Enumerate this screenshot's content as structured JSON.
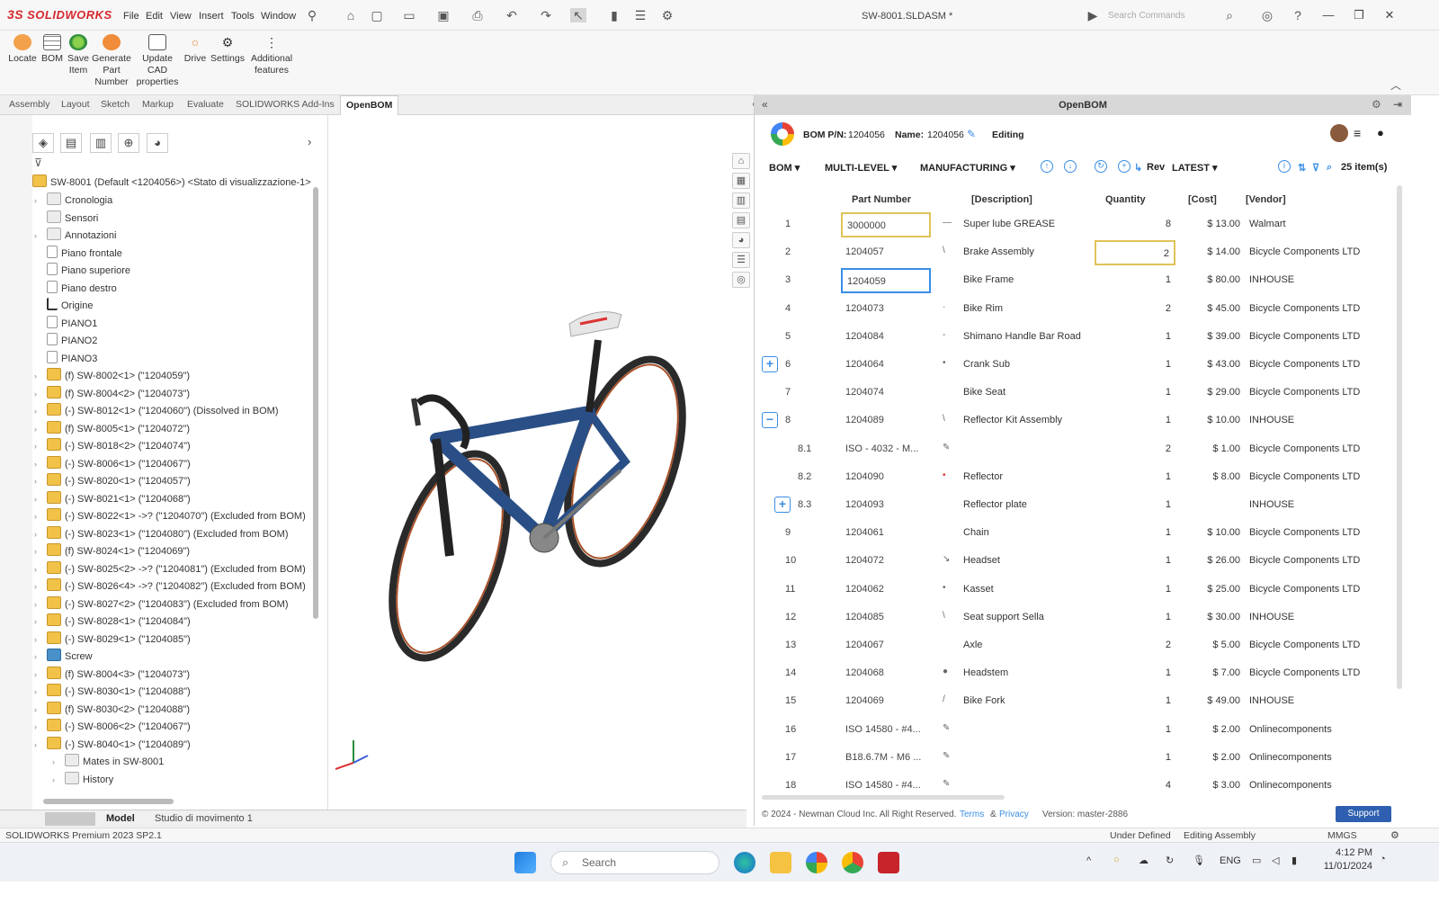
{
  "app": {
    "brand": "SOLIDWORKS",
    "menu": [
      "File",
      "Edit",
      "View",
      "Insert",
      "Tools",
      "Window"
    ],
    "doc_title": "SW-8001.SLDASM *",
    "search_placeholder": "Search Commands"
  },
  "ribbon": {
    "buttons": [
      {
        "label": "Locate",
        "icon": "locate-icon"
      },
      {
        "label": "BOM",
        "icon": "bom-grid-icon"
      },
      {
        "label": "Save Item",
        "icon": "save-item-icon"
      },
      {
        "label": "Generate Part Number",
        "icon": "generate-part-number-icon"
      },
      {
        "label": "Update CAD properties",
        "icon": "update-cad-icon"
      },
      {
        "label": "Drive",
        "icon": "drive-icon"
      },
      {
        "label": "Settings",
        "icon": "gear-icon"
      },
      {
        "label": "Additional features",
        "icon": "more-vertical-icon"
      }
    ]
  },
  "tabs": [
    "Assembly",
    "Layout",
    "Sketch",
    "Markup",
    "Evaluate",
    "SOLIDWORKS Add-Ins",
    "OpenBOM"
  ],
  "tree": {
    "root": "SW-8001 (Default <1204056>) <Stato di visualizzazione-1>",
    "items": [
      {
        "label": "Cronologia",
        "kind": "folder",
        "expand": true
      },
      {
        "label": "Sensori",
        "kind": "folder",
        "expand": false
      },
      {
        "label": "Annotazioni",
        "kind": "folder",
        "expand": true
      },
      {
        "label": "Piano frontale",
        "kind": "plane",
        "expand": false
      },
      {
        "label": "Piano superiore",
        "kind": "plane",
        "expand": false
      },
      {
        "label": "Piano destro",
        "kind": "plane",
        "expand": false
      },
      {
        "label": "Origine",
        "kind": "origin",
        "expand": false
      },
      {
        "label": "PIANO1",
        "kind": "plane",
        "expand": false
      },
      {
        "label": "PIANO2",
        "kind": "plane",
        "expand": false
      },
      {
        "label": "PIANO3",
        "kind": "plane",
        "expand": false
      },
      {
        "label": "(f) SW-8002<1> (\"1204059\")",
        "kind": "asm",
        "expand": true
      },
      {
        "label": "(f) SW-8004<2> (\"1204073\")",
        "kind": "asm",
        "expand": true
      },
      {
        "label": "(-) SW-8012<1> (\"1204060\") (Dissolved in BOM)",
        "kind": "asm",
        "expand": true
      },
      {
        "label": "(f) SW-8005<1> (\"1204072\")",
        "kind": "asm",
        "expand": true
      },
      {
        "label": "(-) SW-8018<2> (\"1204074\")",
        "kind": "asm",
        "expand": true
      },
      {
        "label": "(-) SW-8006<1> (\"1204067\")",
        "kind": "asm",
        "expand": true
      },
      {
        "label": "(-) SW-8020<1> (\"1204057\")",
        "kind": "asm",
        "expand": true
      },
      {
        "label": "(-) SW-8021<1> (\"1204068\")",
        "kind": "asm",
        "expand": true
      },
      {
        "label": "(-) SW-8022<1> ->? (\"1204070\") (Excluded from BOM)",
        "kind": "asm",
        "expand": true
      },
      {
        "label": "(-) SW-8023<1> (\"1204080\") (Excluded from BOM)",
        "kind": "asm",
        "expand": true
      },
      {
        "label": "(f) SW-8024<1> (\"1204069\")",
        "kind": "asm",
        "expand": true
      },
      {
        "label": "(-) SW-8025<2> ->? (\"1204081\") (Excluded from BOM)",
        "kind": "asm",
        "expand": true
      },
      {
        "label": "(-) SW-8026<4> ->? (\"1204082\") (Excluded from BOM)",
        "kind": "asm",
        "expand": true
      },
      {
        "label": "(-) SW-8027<2> (\"1204083\") (Excluded from BOM)",
        "kind": "asm",
        "expand": true
      },
      {
        "label": "(-) SW-8028<1> (\"1204084\")",
        "kind": "asm",
        "expand": true
      },
      {
        "label": "(-) SW-8029<1> (\"1204085\")",
        "kind": "asm",
        "expand": true
      },
      {
        "label": "Screw",
        "kind": "fold2",
        "expand": true
      },
      {
        "label": "(f) SW-8004<3> (\"1204073\")",
        "kind": "asm",
        "expand": true
      },
      {
        "label": "(-) SW-8030<1> (\"1204088\")",
        "kind": "asm",
        "expand": true
      },
      {
        "label": "(f) SW-8030<2> (\"1204088\")",
        "kind": "asm",
        "expand": true
      },
      {
        "label": "(-) SW-8006<2> (\"1204067\")",
        "kind": "asm",
        "expand": true
      },
      {
        "label": "(-) SW-8040<1> (\"1204089\")",
        "kind": "asm",
        "expand": true
      },
      {
        "label": "Mates in SW-8001",
        "kind": "folder",
        "expand": true,
        "indent": true
      },
      {
        "label": "History",
        "kind": "folder",
        "expand": true,
        "indent": true
      }
    ]
  },
  "bottom_tabs": [
    "Model",
    "Studio di movimento 1"
  ],
  "status": {
    "left": "SOLIDWORKS Premium 2023 SP2.1",
    "under_defined": "Under Defined",
    "editing": "Editing Assembly",
    "units": "MMGS"
  },
  "openbom": {
    "panel_title": "OpenBOM",
    "bom_pn_label": "BOM P/N:",
    "bom_pn": "1204056",
    "name_label": "Name:",
    "name": "1204056",
    "mode": "Editing",
    "toolbar": {
      "bom": "BOM",
      "multilevel": "MULTI-LEVEL",
      "manufacturing": "MANUFACTURING",
      "rev": "Rev",
      "latest": "LATEST",
      "item_count": "25 item(s)"
    },
    "columns": {
      "part_number": "Part Number",
      "description": "[Description]",
      "quantity": "Quantity",
      "cost": "[Cost]",
      "vendor": "[Vendor]"
    },
    "rows": [
      {
        "num": "1",
        "pn": "3000000",
        "ic": "—",
        "desc": "Super lube GREASE",
        "qty": "8",
        "cost": "$ 13.00",
        "vendor": "Walmart",
        "pnstate": "hl"
      },
      {
        "num": "2",
        "pn": "1204057",
        "ic": "\\",
        "desc": "Brake Assembly",
        "qty": "2",
        "cost": "$ 14.00",
        "vendor": "Bicycle Components LTD",
        "qtystate": "hl"
      },
      {
        "num": "3",
        "pn": "1204059",
        "ic": "",
        "desc": "Bike Frame",
        "qty": "1",
        "cost": "$ 80.00",
        "vendor": "INHOUSE",
        "pnstate": "sel"
      },
      {
        "num": "4",
        "pn": "1204073",
        "ic": "·",
        "desc": "Bike Rim",
        "qty": "2",
        "cost": "$ 45.00",
        "vendor": "Bicycle Components LTD"
      },
      {
        "num": "5",
        "pn": "1204084",
        "ic": "-",
        "desc": "Shimano Handle Bar Road",
        "qty": "1",
        "cost": "$ 39.00",
        "vendor": "Bicycle Components LTD"
      },
      {
        "num": "6",
        "pn": "1204064",
        "ic": "•",
        "desc": "Crank Sub",
        "qty": "1",
        "cost": "$ 43.00",
        "vendor": "Bicycle Components LTD",
        "exp": "+"
      },
      {
        "num": "7",
        "pn": "1204074",
        "ic": "",
        "desc": "Bike Seat",
        "qty": "1",
        "cost": "$ 29.00",
        "vendor": "Bicycle Components LTD"
      },
      {
        "num": "8",
        "pn": "1204089",
        "ic": "\\",
        "desc": "Reflector Kit Assembly",
        "qty": "1",
        "cost": "$ 10.00",
        "vendor": "INHOUSE",
        "exp": "−"
      },
      {
        "num": "8.1",
        "pn": "ISO - 4032 - M...",
        "ic": "✎",
        "desc": "",
        "qty": "2",
        "cost": "$ 1.00",
        "vendor": "Bicycle Components LTD",
        "sub": true
      },
      {
        "num": "8.2",
        "pn": "1204090",
        "ic": "•",
        "desc": "Reflector",
        "qty": "1",
        "cost": "$ 8.00",
        "vendor": "Bicycle Components LTD",
        "sub": true,
        "iccolor": "#d33"
      },
      {
        "num": "8.3",
        "pn": "1204093",
        "ic": "",
        "desc": "Reflector plate",
        "qty": "1",
        "cost": "",
        "vendor": "INHOUSE",
        "sub": true,
        "exp": "+"
      },
      {
        "num": "9",
        "pn": "1204061",
        "ic": "",
        "desc": "Chain",
        "qty": "1",
        "cost": "$ 10.00",
        "vendor": "Bicycle Components LTD"
      },
      {
        "num": "10",
        "pn": "1204072",
        "ic": "↘",
        "desc": "Headset",
        "qty": "1",
        "cost": "$ 26.00",
        "vendor": "Bicycle Components LTD"
      },
      {
        "num": "11",
        "pn": "1204062",
        "ic": "•",
        "desc": "Kasset",
        "qty": "1",
        "cost": "$ 25.00",
        "vendor": "Bicycle Components LTD"
      },
      {
        "num": "12",
        "pn": "1204085",
        "ic": "\\",
        "desc": "Seat support Sella",
        "qty": "1",
        "cost": "$ 30.00",
        "vendor": "INHOUSE"
      },
      {
        "num": "13",
        "pn": "1204067",
        "ic": "",
        "desc": "Axle",
        "qty": "2",
        "cost": "$ 5.00",
        "vendor": "Bicycle Components LTD"
      },
      {
        "num": "14",
        "pn": "1204068",
        "ic": "●",
        "desc": "Headstem",
        "qty": "1",
        "cost": "$ 7.00",
        "vendor": "Bicycle Components LTD"
      },
      {
        "num": "15",
        "pn": "1204069",
        "ic": "/",
        "desc": "Bike Fork",
        "qty": "1",
        "cost": "$ 49.00",
        "vendor": "INHOUSE"
      },
      {
        "num": "16",
        "pn": "ISO 14580 - #4...",
        "ic": "✎",
        "desc": "",
        "qty": "1",
        "cost": "$ 2.00",
        "vendor": "Onlinecomponents"
      },
      {
        "num": "17",
        "pn": "B18.6.7M - M6 ...",
        "ic": "✎",
        "desc": "",
        "qty": "1",
        "cost": "$ 2.00",
        "vendor": "Onlinecomponents"
      },
      {
        "num": "18",
        "pn": "ISO 14580 - #4...",
        "ic": "✎",
        "desc": "",
        "qty": "4",
        "cost": "$ 3.00",
        "vendor": "Onlinecomponents"
      }
    ],
    "footer": {
      "copyright": "© 2024 - Newman Cloud Inc. All Right Reserved.",
      "terms": "Terms",
      "amp": "&",
      "privacy": "Privacy",
      "version": "Version: master-2886",
      "support": "Support"
    }
  },
  "taskbar": {
    "search_placeholder": "Search",
    "lang": "ENG",
    "time": "4:12 PM",
    "date": "11/01/2024"
  },
  "colors": {
    "accent_blue": "#3a8ee6",
    "highlight_yellow": "#e0c35a",
    "brand_red": "#d6282d"
  }
}
